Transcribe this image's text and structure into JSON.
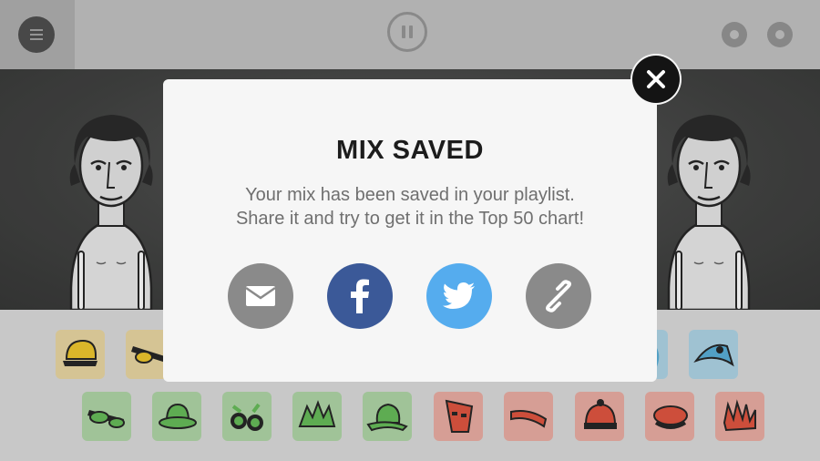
{
  "topbar": {
    "menu_icon": "hamburger-icon",
    "pause_icon": "pause-icon",
    "record_icons": [
      "record-icon",
      "record-icon"
    ]
  },
  "modal": {
    "title": "MIX SAVED",
    "message_line1": "Your mix has been saved in your playlist.",
    "message_line2": "Share it and try to get it in the Top 50 chart!",
    "close_icon": "close-icon",
    "share_buttons": [
      {
        "icon": "email-icon",
        "color": "#8a8a8a"
      },
      {
        "icon": "facebook-icon",
        "color": "#3b5998"
      },
      {
        "icon": "twitter-icon",
        "color": "#55acee"
      },
      {
        "icon": "link-icon",
        "color": "#8a8a8a"
      }
    ]
  },
  "palette": {
    "row1": [
      "yellow-cap-icon",
      "yellow-glasses-icon",
      "blue-item-icon",
      "blue-bird-icon"
    ],
    "row2": [
      "green-mask-icon",
      "green-hat-icon",
      "green-goggles-icon",
      "green-crown-icon",
      "green-fedora-icon",
      "red-mask-icon",
      "red-headband-icon",
      "red-beanie-icon",
      "red-beret-icon",
      "red-glove-icon"
    ],
    "colors": {
      "yellow": "#f0c419",
      "green": "#58b84a",
      "red": "#e0452e",
      "blue": "#4aa9d6"
    }
  }
}
